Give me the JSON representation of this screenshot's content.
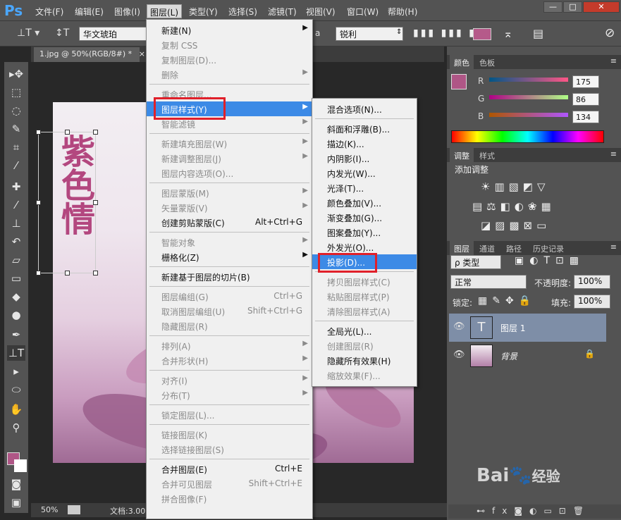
{
  "app": {
    "logo": "Ps"
  },
  "menubar": [
    "文件(F)",
    "编辑(E)",
    "图像(I)",
    "图层(L)",
    "类型(Y)",
    "选择(S)",
    "滤镜(T)",
    "视图(V)",
    "窗口(W)",
    "帮助(H)"
  ],
  "window_buttons": [
    "—",
    "□",
    "✕"
  ],
  "options": {
    "font": "华文琥珀",
    "antialias": "锐利",
    "aa_prefix": "a",
    "color": "#b55a8a"
  },
  "document": {
    "tab": "1.jpg @ 50%(RGB/8#) *",
    "close": "×"
  },
  "status": {
    "zoom": "50%",
    "info": "文档:3.00"
  },
  "layer_menu": [
    {
      "label": "新建(N)",
      "arrow": true
    },
    {
      "label": "复制 CSS",
      "disabled": true
    },
    {
      "label": "复制图层(D)...",
      "disabled": true
    },
    {
      "label": "删除",
      "disabled": true,
      "arrow": true
    },
    {
      "sep": true
    },
    {
      "label": "重命名图层...",
      "disabled": true
    },
    {
      "label": "图层样式(Y)",
      "arrow": true,
      "highlight": true
    },
    {
      "label": "智能滤镜",
      "disabled": true,
      "arrow": true
    },
    {
      "sep": true
    },
    {
      "label": "新建填充图层(W)",
      "disabled": true,
      "arrow": true
    },
    {
      "label": "新建调整图层(J)",
      "disabled": true,
      "arrow": true
    },
    {
      "label": "图层内容选项(O)...",
      "disabled": true
    },
    {
      "sep": true
    },
    {
      "label": "图层蒙版(M)",
      "disabled": true,
      "arrow": true
    },
    {
      "label": "矢量蒙版(V)",
      "disabled": true,
      "arrow": true
    },
    {
      "label": "创建剪贴蒙版(C)",
      "shortcut": "Alt+Ctrl+G"
    },
    {
      "sep": true
    },
    {
      "label": "智能对象",
      "disabled": true,
      "arrow": true
    },
    {
      "label": "栅格化(Z)",
      "arrow": true
    },
    {
      "sep": true
    },
    {
      "label": "新建基于图层的切片(B)"
    },
    {
      "sep": true
    },
    {
      "label": "图层编组(G)",
      "disabled": true,
      "shortcut": "Ctrl+G"
    },
    {
      "label": "取消图层编组(U)",
      "disabled": true,
      "shortcut": "Shift+Ctrl+G"
    },
    {
      "label": "隐藏图层(R)",
      "disabled": true
    },
    {
      "sep": true
    },
    {
      "label": "排列(A)",
      "disabled": true,
      "arrow": true
    },
    {
      "label": "合并形状(H)",
      "disabled": true,
      "arrow": true
    },
    {
      "sep": true
    },
    {
      "label": "对齐(I)",
      "disabled": true,
      "arrow": true
    },
    {
      "label": "分布(T)",
      "disabled": true,
      "arrow": true
    },
    {
      "sep": true
    },
    {
      "label": "锁定图层(L)...",
      "disabled": true
    },
    {
      "sep": true
    },
    {
      "label": "链接图层(K)",
      "disabled": true
    },
    {
      "label": "选择链接图层(S)",
      "disabled": true
    },
    {
      "sep": true
    },
    {
      "label": "合并图层(E)",
      "shortcut": "Ctrl+E"
    },
    {
      "label": "合并可见图层",
      "disabled": true,
      "shortcut": "Shift+Ctrl+E"
    },
    {
      "label": "拼合图像(F)",
      "disabled": true
    }
  ],
  "style_menu": [
    {
      "label": "混合选项(N)..."
    },
    {
      "sep": true
    },
    {
      "label": "斜面和浮雕(B)..."
    },
    {
      "label": "描边(K)..."
    },
    {
      "label": "内阴影(I)..."
    },
    {
      "label": "内发光(W)..."
    },
    {
      "label": "光泽(T)..."
    },
    {
      "label": "颜色叠加(V)..."
    },
    {
      "label": "渐变叠加(G)..."
    },
    {
      "label": "图案叠加(Y)..."
    },
    {
      "label": "外发光(O)..."
    },
    {
      "label": "投影(D)...",
      "highlight": true
    },
    {
      "sep": true
    },
    {
      "label": "拷贝图层样式(C)",
      "disabled": true
    },
    {
      "label": "粘贴图层样式(P)",
      "disabled": true
    },
    {
      "label": "清除图层样式(A)",
      "disabled": true
    },
    {
      "sep": true
    },
    {
      "label": "全局光(L)..."
    },
    {
      "label": "创建图层(R)",
      "disabled": true
    },
    {
      "label": "隐藏所有效果(H)"
    },
    {
      "label": "缩放效果(F)...",
      "disabled": true
    }
  ],
  "color_panel": {
    "tabs": [
      "颜色",
      "色板"
    ],
    "labels": [
      "R",
      "G",
      "B"
    ],
    "values": [
      "175",
      "86",
      "134"
    ],
    "swatch": "#af5686"
  },
  "adjust_panel": {
    "tabs": [
      "调整",
      "样式"
    ],
    "title": "添加调整"
  },
  "layers_panel": {
    "tabs": [
      "图层",
      "通道",
      "路径",
      "历史记录"
    ],
    "filter": "ρ 类型",
    "blend": "正常",
    "opacity_label": "不透明度:",
    "opacity": "100%",
    "lock_label": "锁定:",
    "fill_label": "填充:",
    "fill": "100%",
    "layers": [
      {
        "name": "图层 1",
        "thumb": "T"
      },
      {
        "name": "背景"
      }
    ]
  },
  "watermark": {
    "text": "Bai",
    "sub": "经验",
    "paw": "🐾"
  },
  "canvas_text": "紫色情"
}
